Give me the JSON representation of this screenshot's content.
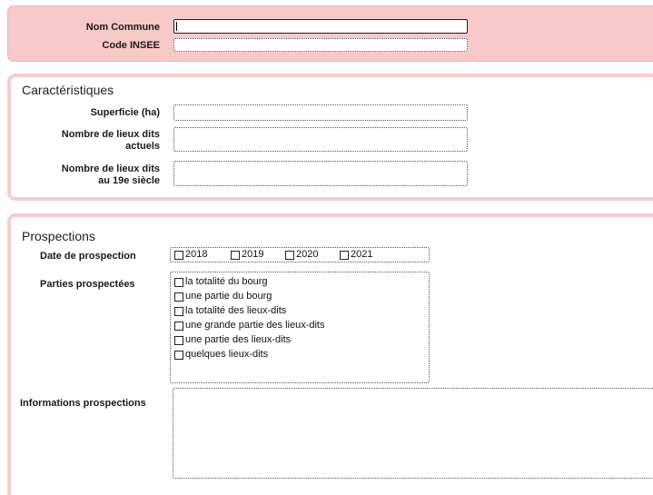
{
  "identity": {
    "nom_commune_label": "Nom Commune",
    "nom_commune_value": "",
    "code_insee_label": "Code INSEE",
    "code_insee_value": ""
  },
  "caracteristiques": {
    "title": "Caractéristiques",
    "superficie_label": "Superficie (ha)",
    "lieux_dits_actuels_label_1": "Nombre de lieux dits",
    "lieux_dits_actuels_label_2": "actuels",
    "lieux_dits_19e_label_1": "Nombre de lieux dits",
    "lieux_dits_19e_label_2": "au 19e siècle"
  },
  "prospections": {
    "title": "Prospections",
    "date_label": "Date de prospection",
    "years": [
      "2018",
      "2019",
      "2020",
      "2021"
    ],
    "parties_label": "Parties prospectées",
    "parties": [
      "la totalité du bourg",
      "une partie du bourg",
      "la totalité des lieux-dits",
      "une grande partie des lieux-dits",
      "une partie des lieux-dits",
      "quelques lieux-dits"
    ],
    "informations_label": "Informations prospections"
  },
  "colors": {
    "section_fill": "#f7c9c9",
    "section_border": "#f7cccc"
  }
}
